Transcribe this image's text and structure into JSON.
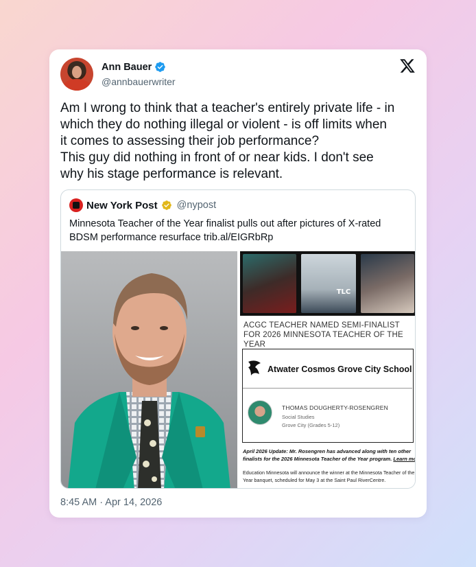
{
  "tweet": {
    "display_name": "Ann Bauer",
    "handle": "@annbauerwriter",
    "verified": true,
    "text_lines": [
      "Am I wrong to think that a teacher's entirely private life - in",
      "which they do nothing illegal or violent - is off limits when",
      "it comes to assessing their job performance?",
      "This guy did nothing in front of or near kids. I don't see",
      "why his stage performance is relevant."
    ],
    "timestamp": "8:45 AM · Apr 14, 2026",
    "platform_icon": "x-logo-icon"
  },
  "quote": {
    "display_name": "New York Post",
    "handle": "@nypost",
    "verified_gold": true,
    "text_lines": [
      "Minnesota Teacher of the Year finalist pulls out after pictures of X-rated",
      "BDSM performance resurface trib.al/EIGRbRp"
    ],
    "image_right": {
      "collage_label": "TLC",
      "headline_lines": [
        "ACGC TEACHER NAMED SEMI-FINALIST",
        "FOR 2026 MINNESOTA TEACHER OF THE",
        "YEAR"
      ],
      "school_name": "Atwater Cosmos Grove City School",
      "teacher_name": "THOMAS DOUGHERTY-ROSENGREN",
      "teacher_subject": "Social Studies",
      "teacher_location": "Grove City (Grades 5-12)",
      "update_lines": [
        "April 2026 Update: Mr. Rosengren has advanced along with ten other",
        "finalists for the 2026 Minnesota Teacher of the Year program."
      ],
      "update_link": "Learn more.",
      "announce_lines": [
        "Education Minnesota will announce the winner at the Minnesota Teacher of the",
        "Year banquet, scheduled for May 3 at the Saint Paul RiverCentre."
      ]
    }
  },
  "colors": {
    "verified_blue": "#1d9bf0",
    "gold_badge": "#e2b719",
    "text_primary": "#0f1419",
    "text_secondary": "#536471"
  }
}
